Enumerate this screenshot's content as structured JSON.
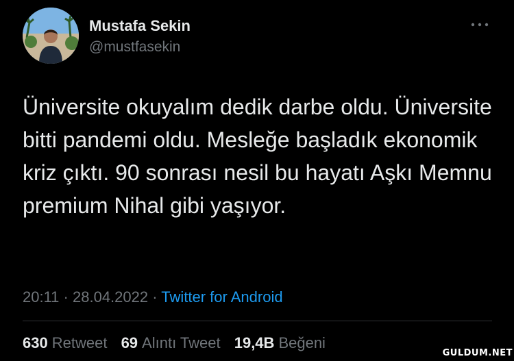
{
  "author": {
    "display_name": "Mustafa Sekin",
    "handle": "@mustfasekin",
    "avatar_icon": "profile-photo"
  },
  "more_icon": "more-horizontal-icon",
  "tweet": {
    "text": "Üniversite okuyalım dedik darbe oldu. Üniversite bitti pandemi oldu. Mesleğe başladık ekonomik kriz çıktı. 90 sonrası nesil bu hayatı Aşkı Memnu premium Nihal gibi yaşıyor."
  },
  "meta": {
    "time": "20:11",
    "separator": "·",
    "date": "28.04.2022",
    "source": "Twitter for Android"
  },
  "stats": {
    "retweets": {
      "count": "630",
      "label": "Retweet"
    },
    "quotes": {
      "count": "69",
      "label": "Alıntı Tweet"
    },
    "likes": {
      "count": "19,4B",
      "label": "Beğeni"
    }
  },
  "watermark": "GULDUM.NET",
  "colors": {
    "background": "#000000",
    "primary_text": "#e7e9ea",
    "secondary_text": "#71767b",
    "link": "#1d9bf0",
    "divider": "#2f3336"
  }
}
